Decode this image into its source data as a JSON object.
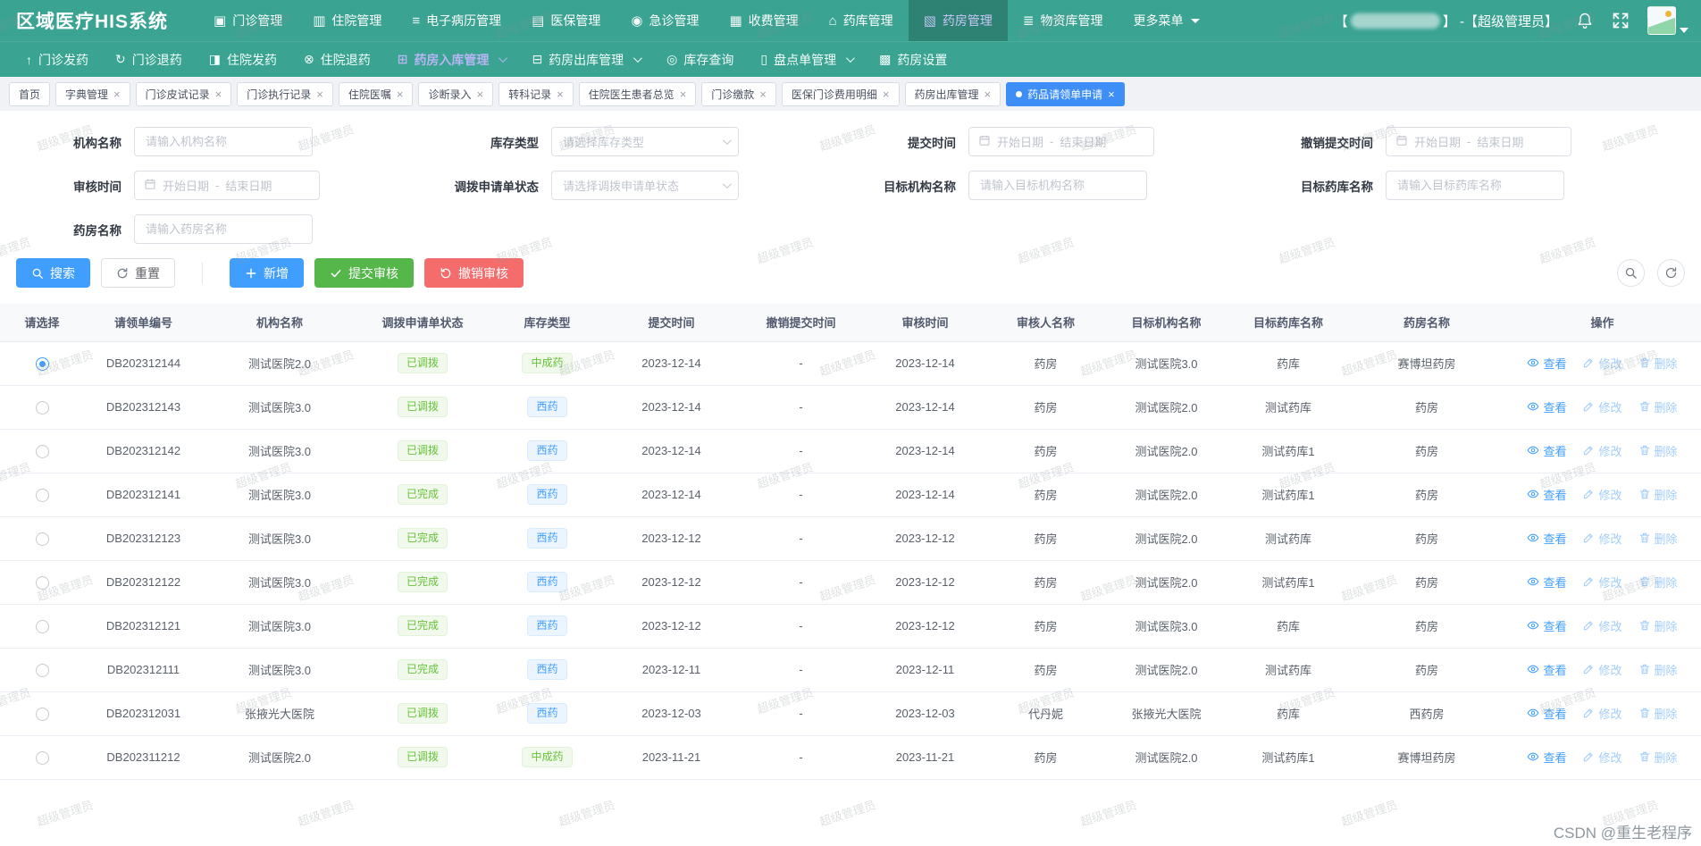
{
  "app": {
    "title": "区域医疗HIS系统",
    "masked_open": "【",
    "masked_close": "】 - ",
    "user_role": "【超级管理员】"
  },
  "top_nav": {
    "items": [
      {
        "label": "门诊管理",
        "icon": "outpatient-icon",
        "glyph": "▣"
      },
      {
        "label": "住院管理",
        "icon": "inpatient-icon",
        "glyph": "▥"
      },
      {
        "label": "电子病历管理",
        "icon": "emr-icon",
        "glyph": "≡"
      },
      {
        "label": "医保管理",
        "icon": "insurance-icon",
        "glyph": "▤"
      },
      {
        "label": "急诊管理",
        "icon": "emergency-icon",
        "glyph": "◉"
      },
      {
        "label": "收费管理",
        "icon": "billing-icon",
        "glyph": "▦"
      },
      {
        "label": "药库管理",
        "icon": "drug-warehouse-icon",
        "glyph": "⌂"
      },
      {
        "label": "药房管理",
        "icon": "pharmacy-icon",
        "glyph": "▧",
        "active": true
      },
      {
        "label": "物资库管理",
        "icon": "materials-icon",
        "glyph": "≣"
      }
    ],
    "more_label": "更多菜单"
  },
  "sub_nav": {
    "items": [
      {
        "label": "门诊发药",
        "icon": "outpatient-dispense-icon",
        "glyph": "↑"
      },
      {
        "label": "门诊退药",
        "icon": "outpatient-return-icon",
        "glyph": "↻"
      },
      {
        "label": "住院发药",
        "icon": "inpatient-dispense-icon",
        "glyph": "◨"
      },
      {
        "label": "住院退药",
        "icon": "inpatient-return-icon",
        "glyph": "⊗"
      },
      {
        "label": "药房入库管理",
        "icon": "pharmacy-inbound-icon",
        "glyph": "⊞",
        "dropdown": true,
        "active": true
      },
      {
        "label": "药房出库管理",
        "icon": "pharmacy-outbound-icon",
        "glyph": "⊟",
        "dropdown": true
      },
      {
        "label": "库存查询",
        "icon": "stock-query-icon",
        "glyph": "◎"
      },
      {
        "label": "盘点单管理",
        "icon": "stocktake-icon",
        "glyph": "▯",
        "dropdown": true
      },
      {
        "label": "药房设置",
        "icon": "pharmacy-settings-icon",
        "glyph": "▩"
      }
    ]
  },
  "tabs": [
    {
      "label": "首页"
    },
    {
      "label": "字典管理",
      "closable": true
    },
    {
      "label": "门诊皮试记录",
      "closable": true
    },
    {
      "label": "门诊执行记录",
      "closable": true
    },
    {
      "label": "住院医嘱",
      "closable": true
    },
    {
      "label": "诊断录入",
      "closable": true
    },
    {
      "label": "转科记录",
      "closable": true
    },
    {
      "label": "住院医生患者总览",
      "closable": true
    },
    {
      "label": "门诊缴款",
      "closable": true
    },
    {
      "label": "医保门诊费用明细",
      "closable": true
    },
    {
      "label": "药房出库管理",
      "closable": true
    },
    {
      "label": "药品请领单申请",
      "closable": true,
      "active": true
    }
  ],
  "filters": {
    "rows": [
      {
        "fields": [
          {
            "name": "org-name",
            "label": "机构名称",
            "type": "input",
            "placeholder": "请输入机构名称"
          },
          {
            "name": "stock-type",
            "label": "库存类型",
            "type": "select",
            "placeholder": "请选择库存类型"
          },
          {
            "name": "submit-time",
            "label": "提交时间",
            "type": "daterange",
            "start": "开始日期",
            "sep": "-",
            "end": "结束日期"
          },
          {
            "name": "revoke-submit-time",
            "label": "撤销提交时间",
            "type": "daterange",
            "start": "开始日期",
            "sep": "-",
            "end": "结束日期"
          }
        ]
      },
      {
        "fields": [
          {
            "name": "audit-time",
            "label": "审核时间",
            "type": "daterange",
            "start": "开始日期",
            "sep": "-",
            "end": "结束日期"
          },
          {
            "name": "transfer-status",
            "label": "调拨申请单状态",
            "type": "select",
            "placeholder": "请选择调拨申请单状态"
          },
          {
            "name": "target-org-name",
            "label": "目标机构名称",
            "type": "input",
            "placeholder": "请输入目标机构名称"
          },
          {
            "name": "target-store-name",
            "label": "目标药库名称",
            "type": "input",
            "placeholder": "请输入目标药库名称"
          }
        ]
      },
      {
        "fields": [
          {
            "name": "pharmacy-name",
            "label": "药房名称",
            "type": "input",
            "placeholder": "请输入药房名称"
          }
        ]
      }
    ]
  },
  "toolbar": {
    "search": "搜索",
    "reset": "重置",
    "add": "新增",
    "submit_audit": "提交审核",
    "revoke_audit": "撤销审核"
  },
  "table": {
    "columns": [
      "请选择",
      "请领单编号",
      "机构名称",
      "调拨申请单状态",
      "库存类型",
      "提交时间",
      "撤销提交时间",
      "审核时间",
      "审核人名称",
      "目标机构名称",
      "目标药库名称",
      "药房名称",
      "操作"
    ],
    "actions": [
      {
        "label": "查看",
        "icon": "eye-icon",
        "style": "primary"
      },
      {
        "label": "修改",
        "icon": "edit-icon",
        "style": "muted"
      },
      {
        "label": "删除",
        "icon": "trash-icon",
        "style": "muted"
      }
    ],
    "rows": [
      {
        "selected": true,
        "id": "DB202312144",
        "org": "测试医院2.0",
        "status": "已调拨",
        "status_color": "green",
        "stock": "中成药",
        "stock_color": "green",
        "submit": "2023-12-14",
        "revoke": "-",
        "audit": "2023-12-14",
        "auditor": "药房",
        "target_org": "测试医院3.0",
        "target_store": "药库",
        "pharmacy": "赛博坦药房"
      },
      {
        "selected": false,
        "id": "DB202312143",
        "org": "测试医院3.0",
        "status": "已调拨",
        "status_color": "green",
        "stock": "西药",
        "stock_color": "blue",
        "submit": "2023-12-14",
        "revoke": "-",
        "audit": "2023-12-14",
        "auditor": "药房",
        "target_org": "测试医院2.0",
        "target_store": "测试药库",
        "pharmacy": "药房"
      },
      {
        "selected": false,
        "id": "DB202312142",
        "org": "测试医院3.0",
        "status": "已调拨",
        "status_color": "green",
        "stock": "西药",
        "stock_color": "blue",
        "submit": "2023-12-14",
        "revoke": "-",
        "audit": "2023-12-14",
        "auditor": "药房",
        "target_org": "测试医院2.0",
        "target_store": "测试药库1",
        "pharmacy": "药房"
      },
      {
        "selected": false,
        "id": "DB202312141",
        "org": "测试医院3.0",
        "status": "已完成",
        "status_color": "green",
        "stock": "西药",
        "stock_color": "blue",
        "submit": "2023-12-14",
        "revoke": "-",
        "audit": "2023-12-14",
        "auditor": "药房",
        "target_org": "测试医院2.0",
        "target_store": "测试药库1",
        "pharmacy": "药房"
      },
      {
        "selected": false,
        "id": "DB202312123",
        "org": "测试医院3.0",
        "status": "已完成",
        "status_color": "green",
        "stock": "西药",
        "stock_color": "blue",
        "submit": "2023-12-12",
        "revoke": "-",
        "audit": "2023-12-12",
        "auditor": "药房",
        "target_org": "测试医院2.0",
        "target_store": "测试药库",
        "pharmacy": "药房"
      },
      {
        "selected": false,
        "id": "DB202312122",
        "org": "测试医院3.0",
        "status": "已完成",
        "status_color": "green",
        "stock": "西药",
        "stock_color": "blue",
        "submit": "2023-12-12",
        "revoke": "-",
        "audit": "2023-12-12",
        "auditor": "药房",
        "target_org": "测试医院2.0",
        "target_store": "测试药库1",
        "pharmacy": "药房"
      },
      {
        "selected": false,
        "id": "DB202312121",
        "org": "测试医院3.0",
        "status": "已完成",
        "status_color": "green",
        "stock": "西药",
        "stock_color": "blue",
        "submit": "2023-12-12",
        "revoke": "-",
        "audit": "2023-12-12",
        "auditor": "药房",
        "target_org": "测试医院3.0",
        "target_store": "药库",
        "pharmacy": "药房"
      },
      {
        "selected": false,
        "id": "DB202312111",
        "org": "测试医院3.0",
        "status": "已完成",
        "status_color": "green",
        "stock": "西药",
        "stock_color": "blue",
        "submit": "2023-12-11",
        "revoke": "-",
        "audit": "2023-12-11",
        "auditor": "药房",
        "target_org": "测试医院2.0",
        "target_store": "测试药库",
        "pharmacy": "药房"
      },
      {
        "selected": false,
        "id": "DB202312031",
        "org": "张掖光大医院",
        "status": "已调拨",
        "status_color": "green",
        "stock": "西药",
        "stock_color": "blue",
        "submit": "2023-12-03",
        "revoke": "-",
        "audit": "2023-12-03",
        "auditor": "代丹妮",
        "target_org": "张掖光大医院",
        "target_store": "药库",
        "pharmacy": "西药房"
      },
      {
        "selected": false,
        "id": "DB202311212",
        "org": "测试医院2.0",
        "status": "已调拨",
        "status_color": "green",
        "stock": "中成药",
        "stock_color": "green",
        "submit": "2023-11-21",
        "revoke": "-",
        "audit": "2023-11-21",
        "auditor": "药房",
        "target_org": "测试医院2.0",
        "target_store": "测试药库1",
        "pharmacy": "赛博坦药房"
      }
    ]
  },
  "watermark": {
    "text": "超级管理员",
    "credit": "CSDN @重生老程序"
  }
}
